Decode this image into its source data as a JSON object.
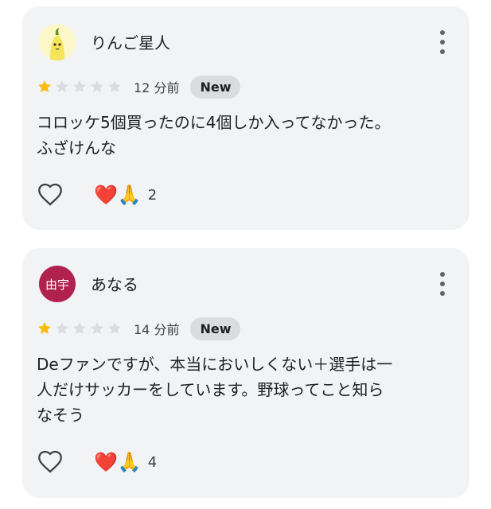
{
  "reviews": [
    {
      "author": "りんご星人",
      "avatar_text": "",
      "rating": 1,
      "max_rating": 5,
      "time": "12 分前",
      "badge": "New",
      "text_lines": [
        "コロッケ5個買ったのに4個しか入ってなかった。",
        "ふざけんな"
      ],
      "reactions": "❤️🙏",
      "reaction_count": "2"
    },
    {
      "author": "あなる",
      "avatar_text": "由宇",
      "rating": 1,
      "max_rating": 5,
      "time": "14 分前",
      "badge": "New",
      "text_lines": [
        "Deファンですが、本当においしくない＋選手は一",
        "人だけサッカーをしています。野球ってこと知ら",
        "なそう"
      ],
      "reactions": "❤️🙏",
      "reaction_count": "4"
    }
  ],
  "colors": {
    "card_bg": "#f1f3f4",
    "star_filled": "#fbbc04",
    "star_empty": "#dadce0",
    "badge_bg": "#dadce0",
    "avatar2_bg": "#b0214f"
  },
  "icons": {
    "menu": "more-vert-icon",
    "like": "heart-outline-icon",
    "star": "star-icon"
  }
}
